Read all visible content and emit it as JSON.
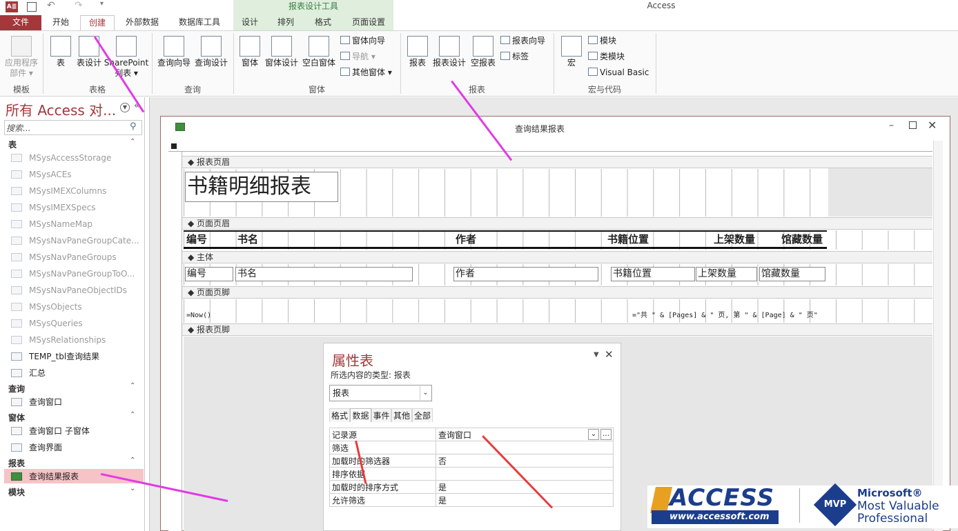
{
  "app": {
    "title": "Access",
    "access_logo": "A≣"
  },
  "report_tools": {
    "title": "报表设计工具",
    "tabs": [
      "设计",
      "排列",
      "格式",
      "页面设置"
    ]
  },
  "tabs": [
    "文件",
    "开始",
    "创建",
    "外部数据",
    "数据库工具"
  ],
  "ribbon": {
    "groups": [
      "模板",
      "表格",
      "查询",
      "窗体",
      "报表",
      "宏与代码"
    ],
    "template": {
      "app_parts": "应用程序\n部件 ▾"
    },
    "tables": {
      "table": "表",
      "table_design": "表设计",
      "sharepoint": "SharePoint\n列表 ▾"
    },
    "queries": {
      "wizard": "查询向导",
      "design": "查询设计"
    },
    "forms": {
      "form": "窗体",
      "form_design": "窗体设计",
      "blank_form": "空白窗体",
      "form_wizard": "窗体向导",
      "navigation": "导航 ▾",
      "more_forms": "其他窗体 ▾"
    },
    "reports": {
      "report": "报表",
      "report_design": "报表设计",
      "blank_report": "空报表",
      "report_wizard": "报表向导",
      "labels": "标签"
    },
    "macros": {
      "macro": "宏",
      "module": "模块",
      "class_module": "类模块",
      "visual_basic": "Visual Basic"
    }
  },
  "nav": {
    "title": "所有 Access 对...",
    "search_placeholder": "搜索...",
    "sections": {
      "tables": "表",
      "queries": "查询",
      "forms": "窗体",
      "reports": "报表",
      "modules": "模块"
    },
    "tables": [
      "MSysAccessStorage",
      "MSysACEs",
      "MSysIMEXColumns",
      "MSysIMEXSpecs",
      "MSysNameMap",
      "MSysNavPaneGroupCate...",
      "MSysNavPaneGroups",
      "MSysNavPaneGroupToO...",
      "MSysNavPaneObjectIDs",
      "MSysObjects",
      "MSysQueries",
      "MSysRelationships",
      "TEMP_tbl查询结果",
      "汇总"
    ],
    "queries": [
      "查询窗口"
    ],
    "forms": [
      "查询窗口 子窗体",
      "查询界面"
    ],
    "reports": [
      "查询结果报表"
    ]
  },
  "report_window": {
    "title": "查询结果报表",
    "sections": {
      "report_header": "报表页眉",
      "page_header": "页面页眉",
      "detail": "主体",
      "page_footer": "页面页脚",
      "report_footer": "报表页脚"
    },
    "report_title": "书籍明细报表",
    "headers": [
      "编号",
      "书名",
      "作者",
      "书籍位置",
      "上架数量",
      "馆藏数量"
    ],
    "fields": [
      "编号",
      "书名",
      "作者",
      "书籍位置",
      "上架数量",
      "馆藏数量"
    ],
    "footer_now": "=Now()",
    "footer_pages": "=\"共 \" & [Pages] & \" 页, 第 \" & [Page] & \" 页\""
  },
  "property_sheet": {
    "title": "属性表",
    "type_label": "所选内容的类型: 报表",
    "selected": "报表",
    "tabs": [
      "格式",
      "数据",
      "事件",
      "其他",
      "全部"
    ],
    "active_tab": "数据",
    "rows": [
      {
        "key": "记录源",
        "value": "查询窗口"
      },
      {
        "key": "筛选",
        "value": ""
      },
      {
        "key": "加载时的筛选器",
        "value": "否"
      },
      {
        "key": "排序依据",
        "value": ""
      },
      {
        "key": "加载时的排序方式",
        "value": "是"
      },
      {
        "key": "允许筛选",
        "value": "是"
      }
    ]
  },
  "watermark": {
    "access": "ACCESS",
    "url": "www.accessoft.com",
    "mvp": "MVP",
    "ms1": "Microsoft®",
    "ms2": "Most Valuable",
    "ms3": "Professional"
  }
}
